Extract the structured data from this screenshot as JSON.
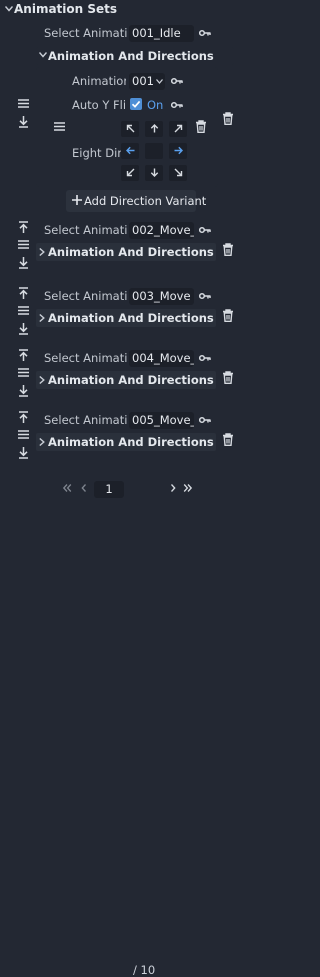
{
  "header": {
    "title": "Animation Sets"
  },
  "set1": {
    "select_label": "Select Animatio",
    "select_value": "001_Idle",
    "section_title": "Animation And Directions",
    "animation_label": "Animation",
    "animation_value": "001",
    "auto_y_label": "Auto Y Fli",
    "auto_y_state": "On",
    "eight_dir_label": "Eight Dir",
    "add_variant_label": "Add Direction Variant"
  },
  "sets": [
    {
      "select_label": "Select Animatio",
      "select_value": "002_Move_",
      "section_title": "Animation And Directions"
    },
    {
      "select_label": "Select Animatio",
      "select_value": "003_Move",
      "section_title": "Animation And Directions"
    },
    {
      "select_label": "Select Animatio",
      "select_value": "004_Move_",
      "section_title": "Animation And Directions"
    },
    {
      "select_label": "Select Animatio",
      "select_value": "005_Move_",
      "section_title": "Animation And Directions"
    }
  ],
  "pager": {
    "current": "1",
    "total": "/ 10"
  },
  "colors": {
    "background": "#232833",
    "accent": "#4f8fd6",
    "panel": "#21262f"
  },
  "icons": [
    "key-icon",
    "list-icon",
    "arrow-up-to-line-icon",
    "arrow-down-to-line-icon",
    "trash-icon",
    "plus-icon",
    "chevron-icon"
  ]
}
